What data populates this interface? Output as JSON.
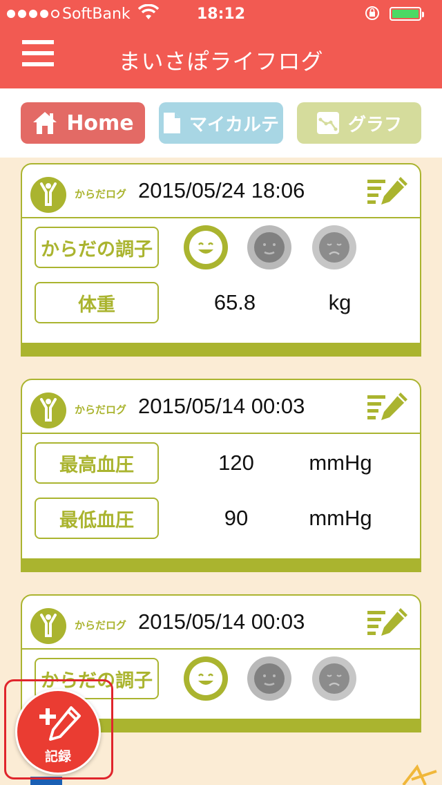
{
  "status_bar": {
    "carrier": "SoftBank",
    "time": "18:12",
    "signal_bars_filled": 4,
    "signal_bars_total": 5,
    "battery_level": 1.0
  },
  "header": {
    "title": "まいさぽライフログ",
    "menu_icon": "hamburger-menu-icon"
  },
  "tabs": [
    {
      "label": "Home",
      "icon": "house-icon",
      "color": "#e36a65"
    },
    {
      "label": "マイカルテ",
      "icon": "document-icon",
      "color": "#a8d6e4"
    },
    {
      "label": "グラフ",
      "icon": "line-chart-icon",
      "color": "#d5dc9c"
    }
  ],
  "cards": [
    {
      "kind": "からだログ",
      "datetime": "2015/05/24 18:06",
      "rows": [
        {
          "label": "からだの調子",
          "type": "condition",
          "selected": "good"
        },
        {
          "label": "体重",
          "value": "65.8",
          "unit": "kg"
        }
      ]
    },
    {
      "kind": "からだログ",
      "datetime": "2015/05/14 00:03",
      "rows": [
        {
          "label": "最高血圧",
          "value": "120",
          "unit": "mmHg"
        },
        {
          "label": "最低血圧",
          "value": "90",
          "unit": "mmHg"
        }
      ]
    },
    {
      "kind": "からだログ",
      "datetime": "2015/05/14 00:03",
      "rows": [
        {
          "label": "からだの調子",
          "type": "condition",
          "selected": "good"
        }
      ]
    }
  ],
  "fab": {
    "label": "記録",
    "icon": "plus-pencil-icon"
  },
  "colors": {
    "header": "#f25a52",
    "accent": "#aab42f",
    "background": "#fbecd5",
    "fab": "#ea3c32",
    "highlight_frame": "#e0252c"
  }
}
